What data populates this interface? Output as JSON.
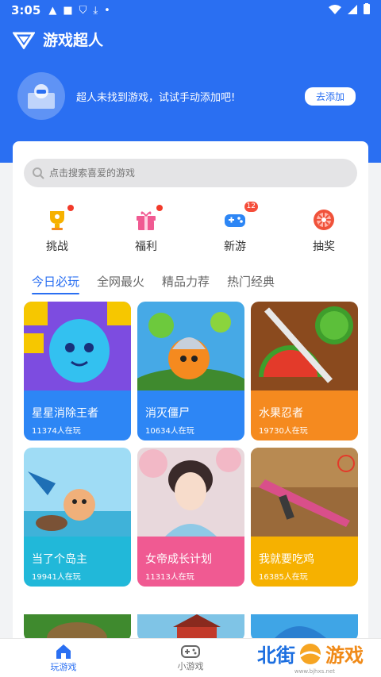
{
  "status_bar": {
    "time": "3:05"
  },
  "app": {
    "title": "游戏超人"
  },
  "banner": {
    "message": "超人未找到游戏，试试手动添加吧!",
    "add_button": "去添加"
  },
  "search": {
    "placeholder": "点击搜索喜爱的游戏"
  },
  "categories": [
    {
      "label": "挑战",
      "icon": "trophy-icon"
    },
    {
      "label": "福利",
      "icon": "gift-icon"
    },
    {
      "label": "新游",
      "icon": "gamepad-icon",
      "badge": "12"
    },
    {
      "label": "抽奖",
      "icon": "wheel-icon"
    }
  ],
  "tabs": [
    "今日必玩",
    "全网最火",
    "精品力荐",
    "热门经典"
  ],
  "games": [
    {
      "name": "星星消除王者",
      "players": "11374人在玩",
      "color": "#2d86f5"
    },
    {
      "name": "消灭僵尸",
      "players": "10634人在玩",
      "color": "#2d86f5"
    },
    {
      "name": "水果忍者",
      "players": "19730人在玩",
      "color": "#f58a1f"
    },
    {
      "name": "当了个岛主",
      "players": "19941人在玩",
      "color": "#21b8d9"
    },
    {
      "name": "女帝成长计划",
      "players": "11313人在玩",
      "color": "#f05a92"
    },
    {
      "name": "我就要吃鸡",
      "players": "16385人在玩",
      "color": "#f6b100"
    }
  ],
  "bottom_nav": [
    {
      "label": "玩游戏",
      "icon": "home-icon",
      "active": true
    },
    {
      "label": "小游戏",
      "icon": "controller-icon",
      "active": false
    }
  ],
  "watermark": {
    "part1": "北街",
    "part2": "游戏",
    "url": "www.bjhxs.net"
  },
  "colors": {
    "primary": "#2a6ff2",
    "background": "#f2f3f5"
  }
}
